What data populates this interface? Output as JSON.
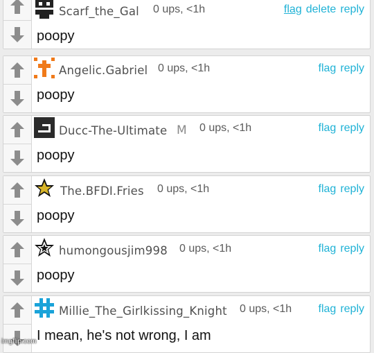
{
  "comments": [
    {
      "username": "Scarf_the_Gal",
      "mod_badge": "",
      "meta": "0 ups, <1h",
      "actions": [
        "flag",
        "delete",
        "reply"
      ],
      "text": "poopy",
      "avatar_icon": "black-pixel-face-icon"
    },
    {
      "username": "Angelic.Gabriel",
      "mod_badge": "",
      "meta": "0 ups, <1h",
      "actions": [
        "flag",
        "reply"
      ],
      "text": "poopy",
      "avatar_icon": "orange-cross-icon"
    },
    {
      "username": "Ducc-The-Ultimate",
      "mod_badge": "M",
      "meta": "0 ups, <1h",
      "actions": [
        "flag",
        "reply"
      ],
      "text": "poopy",
      "avatar_icon": "black-block-logo-icon"
    },
    {
      "username": "The.BFDI.Fries",
      "mod_badge": "",
      "meta": "0 ups, <1h",
      "actions": [
        "flag",
        "reply"
      ],
      "text": "poopy",
      "avatar_icon": "gold-star-icon"
    },
    {
      "username": "humongousjim998",
      "mod_badge": "",
      "meta": "0 ups, <1h",
      "actions": [
        "flag",
        "reply"
      ],
      "text": "poopy",
      "avatar_icon": "black-white-star-icon"
    },
    {
      "username": "Millie_The_Girlkissing_Knight",
      "mod_badge": "",
      "meta": "0 ups, <1h",
      "actions": [
        "flag",
        "reply"
      ],
      "text": "I mean, he's not wrong, I am",
      "avatar_icon": "blue-hashtag-icon"
    }
  ],
  "watermark": "imgflip.com",
  "colors": {
    "link": "#1fb2d6",
    "arrow": "#8c8c8c",
    "background": "#ececec"
  }
}
